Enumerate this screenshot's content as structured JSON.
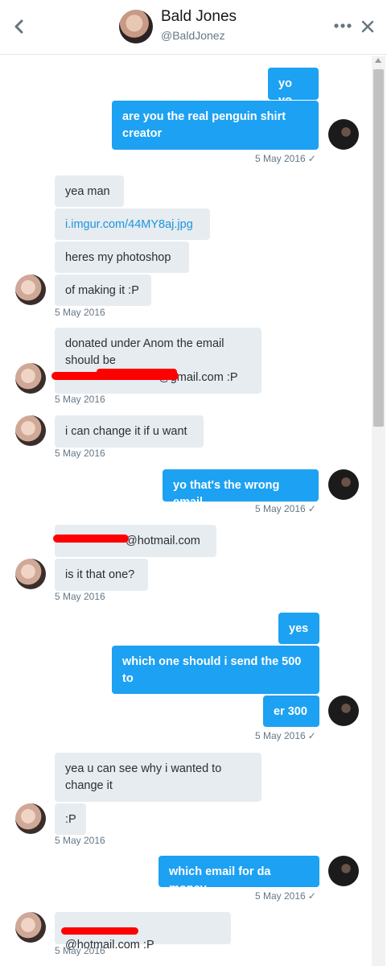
{
  "header": {
    "name": "Bald Jones",
    "handle": "@BaldJonez"
  },
  "messages": {
    "m1": "yo yo",
    "m2": "are you the real penguin shirt creator",
    "t1": "5 May 2016",
    "m3": "yea man",
    "m4": "i.imgur.com/44MY8aj.jpg",
    "m5": "heres my photoshop",
    "m6": "of making it :P",
    "t2": "5 May 2016",
    "m7a": "donated under Anom the email should be",
    "m7b": "@gmail.com :P",
    "t3": "5 May 2016",
    "m8": "i can change it if u want",
    "t4": "5 May 2016",
    "m9": "yo that's the wrong email",
    "t5": "5 May 2016",
    "m10": "@hotmail.com",
    "m11": "is it that one?",
    "t6": "5 May 2016",
    "m12": "yes",
    "m13": "which one should i send the 500 to",
    "m14": "er 300",
    "t7": "5 May 2016",
    "m15": "yea u can see why i wanted to change it",
    "m16": ":P",
    "t8": "5 May 2016",
    "m17": "which email for da money",
    "t9": "5 May 2016",
    "m18": "@hotmail.com :P",
    "t10": "5 May 2016"
  },
  "icons": {
    "back": "chevron-left-icon",
    "more": "ellipsis-icon",
    "close": "close-icon",
    "read": "checkmark-icon"
  },
  "colors": {
    "outgoing": "#1da1f2",
    "incoming": "#e6ecf0",
    "link": "#1b95e0",
    "redaction": "#ff0000"
  }
}
